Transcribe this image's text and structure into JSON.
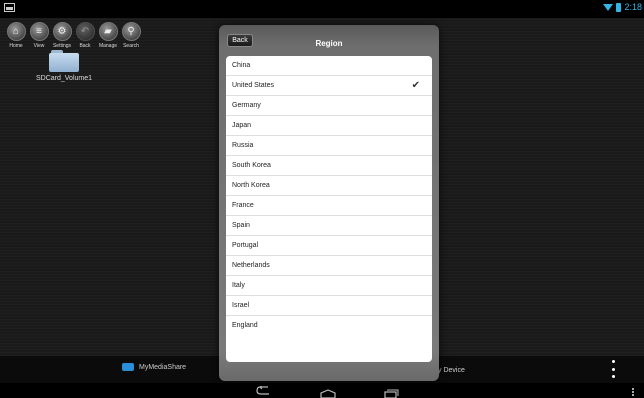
{
  "statusbar": {
    "time": "2:18"
  },
  "toolbar": {
    "buttons": [
      {
        "label": "Home",
        "glyph": "⌂"
      },
      {
        "label": "View",
        "glyph": "≡"
      },
      {
        "label": "Settings",
        "glyph": "⚙"
      },
      {
        "label": "Back",
        "glyph": "↶"
      },
      {
        "label": "Manage",
        "glyph": "▰"
      },
      {
        "label": "Search",
        "glyph": "⚲"
      }
    ]
  },
  "folder": {
    "label": "SDCard_Volume1"
  },
  "bottom": {
    "mymediashare": "MyMediaShare",
    "device_partial": "y Device"
  },
  "dialog": {
    "back_label": "Back",
    "title": "Region",
    "selected": "United States",
    "regions": [
      "China",
      "United States",
      "Germany",
      "Japan",
      "Russia",
      "South Korea",
      "North Korea",
      "France",
      "Spain",
      "Portugal",
      "Netherlands",
      "Italy",
      "Israel",
      "England"
    ]
  },
  "colors": {
    "accent": "#33b5e5",
    "folder": "#b8d0e8",
    "mms_icon": "#2a8fd8"
  }
}
